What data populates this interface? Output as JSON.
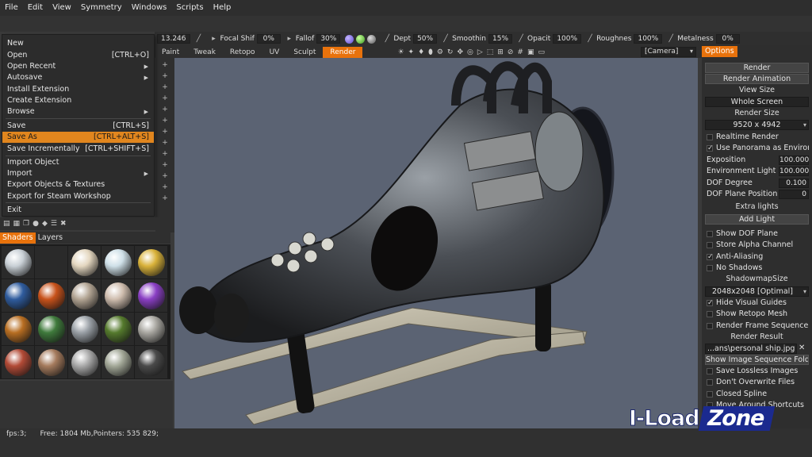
{
  "menubar": [
    "File",
    "Edit",
    "View",
    "Symmetry",
    "Windows",
    "Scripts",
    "Help"
  ],
  "toolbar": {
    "radius_value": "13.246",
    "focal_shift_label": "Focal Shif",
    "focal_shift_value": "0%",
    "falloff_label": "Fallof",
    "falloff_value": "30%",
    "depth_label": "Dept",
    "depth_value": "50%",
    "smoothing_label": "Smoothin",
    "smoothing_value": "15%",
    "opacity_label": "Opacit",
    "opacity_value": "100%",
    "roughness_label": "Roughnes",
    "roughness_value": "100%",
    "metalness_label": "Metalness",
    "metalness_value": "0%"
  },
  "rooms": [
    "Paint",
    "Tweak",
    "Retopo",
    "UV",
    "Sculpt",
    "Render"
  ],
  "active_room": "Render",
  "camera": "[Camera]",
  "file_menu": {
    "items": [
      {
        "label": "New"
      },
      {
        "label": "Open",
        "shortcut": "[CTRL+O]"
      },
      {
        "label": "Open Recent",
        "submenu": true
      },
      {
        "label": "Autosave",
        "submenu": true
      },
      {
        "label": "Install Extension"
      },
      {
        "label": "Create Extension"
      },
      {
        "label": "Browse",
        "submenu": true
      },
      {
        "label": "Save",
        "shortcut": "[CTRL+S]"
      },
      {
        "label": "Save As",
        "shortcut": "[CTRL+ALT+S]",
        "highlighted": true
      },
      {
        "label": "Save Incrementally",
        "shortcut": "[CTRL+SHIFT+S]"
      },
      {
        "label": "Import Object"
      },
      {
        "label": "Import",
        "submenu": true
      },
      {
        "label": "Export Objects & Textures"
      },
      {
        "label": "Export for Steam Workshop"
      },
      {
        "label": "Exit"
      }
    ]
  },
  "panel_tabs": [
    "Shaders",
    "Layers"
  ],
  "shaders": [
    "#c9d0d6",
    "#111111",
    "#e4d7c0",
    "#cfe0e8",
    "#d9b23a",
    "#2f5c9e",
    "#c8521b",
    "#b2a493",
    "#cfbdae",
    "#8a3fc4",
    "#b86e22",
    "#3f7a3c",
    "#9aa0a6",
    "#557a2d",
    "#a9a7a1",
    "#b24a36",
    "#a57b5d",
    "#a9a9a9",
    "#a3a898",
    "#4a4a4a"
  ],
  "status": "fps:3;      Free: 1804 Mb,Pointers: 535 829;",
  "options_tab": "Options",
  "options": {
    "render_btn": "Render",
    "render_animation_btn": "Render Animation",
    "view_size_label": "View Size",
    "view_size_value": "Whole Screen",
    "render_size_label": "Render Size",
    "render_size_value": "9520 x 4942",
    "realtime_render": "Realtime Render",
    "use_panorama": "Use Panorama as Environment",
    "exposition_label": "Exposition",
    "exposition_value": "100.000",
    "env_light_label": "Environment Light",
    "env_light_value": "100.000",
    "dof_degree_label": "DOF Degree",
    "dof_degree_value": "0.100",
    "dof_plane_label": "DOF Plane Position",
    "dof_plane_value": "0",
    "extra_lights_label": "Extra lights",
    "add_light_btn": "Add Light",
    "show_dof_plane": "Show DOF Plane",
    "store_alpha": "Store Alpha Channel",
    "anti_aliasing": "Anti-Aliasing",
    "no_shadows": "No Shadows",
    "shadowmap_label": "ShadowmapSize",
    "shadowmap_value": "2048x2048 [Optimal]",
    "hide_visual_guides": "Hide Visual Guides",
    "show_retopo_mesh": "Show Retopo Mesh",
    "render_frame_seq": "Render Frame Sequence",
    "render_result_label": "Render Result",
    "render_result_value": "...ans\\personal ship.jpg",
    "show_image_seq_btn": "Show Image Sequence Folder",
    "save_lossless": "Save Lossless Images",
    "dont_overwrite": "Don't Overwrite Files",
    "closed_spline": "Closed Spline",
    "move_around": "Move Around Shortcuts"
  },
  "watermark": {
    "part1": "I-Load",
    "part2": "Zone"
  }
}
